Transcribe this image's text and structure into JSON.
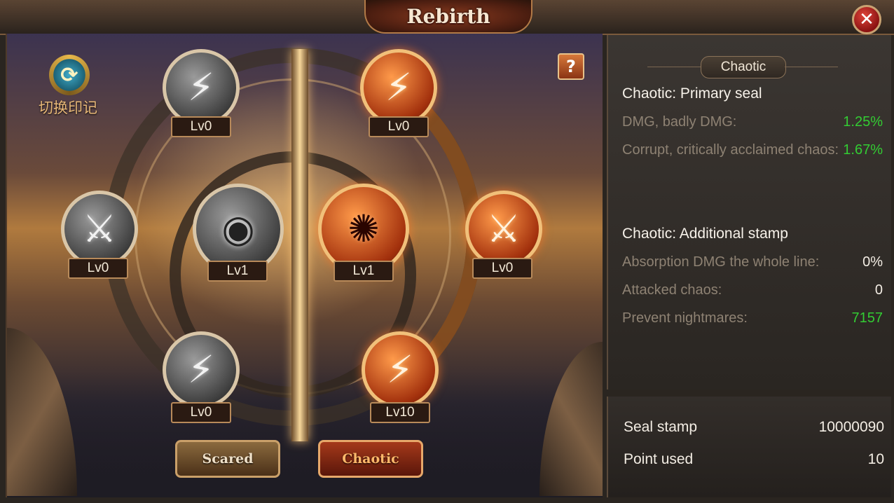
{
  "window": {
    "title": "Rebirth",
    "close_glyph": "✕"
  },
  "left_panel": {
    "switch_mark_label": "切换印记",
    "help_glyph": "?",
    "nodes": [
      {
        "id": "sacred-top",
        "icon": "arrow-burst-icon",
        "glyph": "⚡",
        "level": "Lv0",
        "side": "sacred"
      },
      {
        "id": "sacred-left",
        "icon": "crossed-swords-icon",
        "glyph": "⚔",
        "level": "Lv0",
        "side": "sacred"
      },
      {
        "id": "sacred-center",
        "icon": "eye-emblem-icon",
        "glyph": "◉",
        "level": "Lv1",
        "side": "sacred"
      },
      {
        "id": "sacred-bottom",
        "icon": "lightning-blade-icon",
        "glyph": "⚡",
        "level": "Lv0",
        "side": "sacred"
      },
      {
        "id": "chaotic-top",
        "icon": "arrow-burst-icon",
        "glyph": "⚡",
        "level": "Lv0",
        "side": "chaotic"
      },
      {
        "id": "chaotic-center",
        "icon": "chaos-emblem-icon",
        "glyph": "✺",
        "level": "Lv1",
        "side": "chaotic"
      },
      {
        "id": "chaotic-right",
        "icon": "crossed-swords-icon",
        "glyph": "⚔",
        "level": "Lv0",
        "side": "chaotic"
      },
      {
        "id": "chaotic-bottom",
        "icon": "lightning-blade-icon",
        "glyph": "⚡",
        "level": "Lv10",
        "side": "chaotic"
      }
    ],
    "tabs": {
      "scared": "Scared",
      "chaotic": "Chaotic"
    }
  },
  "right_panel": {
    "header": "Chaotic",
    "primary": {
      "title": "Chaotic: Primary seal",
      "stats": [
        {
          "label": "DMG, badly DMG:",
          "value": "1.25%",
          "color": "#33cc33"
        },
        {
          "label": "Corrupt, critically acclaimed chaos:",
          "value": "1.67%",
          "color": "#33cc33"
        }
      ]
    },
    "additional": {
      "title": "Chaotic: Additional stamp",
      "stats": [
        {
          "label": "Absorption DMG the whole line:",
          "value": "0%",
          "color": "#f3ede4"
        },
        {
          "label": "Attacked chaos:",
          "value": "0",
          "color": "#f3ede4"
        },
        {
          "label": "Prevent nightmares:",
          "value": "7157",
          "color": "#33cc33"
        }
      ]
    }
  },
  "bottom_panel": {
    "seal_stamp_label": "Seal stamp",
    "seal_stamp_value": "10000090",
    "point_used_label": "Point used",
    "point_used_value": "10"
  },
  "colors": {
    "accent_green": "#33cc33",
    "fire": "#c9461a",
    "frame_gold": "#b88a5a"
  }
}
